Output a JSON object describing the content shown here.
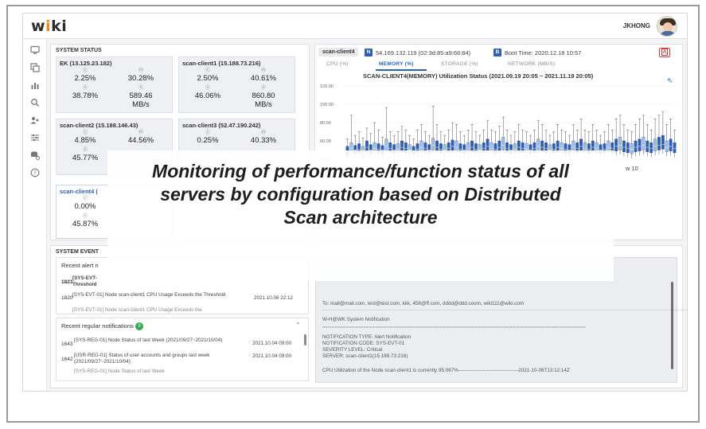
{
  "app": {
    "logo_text": "wiki",
    "user_name": "JKHONG"
  },
  "sidebar": {
    "icons": [
      "monitor-icon",
      "refresh-icon",
      "bar-chart-icon",
      "search-icon",
      "users-icon",
      "sliders-icon",
      "database-settings-icon",
      "help-icon"
    ]
  },
  "system_status": {
    "title": "SYSTEM STATUS",
    "cards": [
      {
        "name": "EK (13.125.23.182)",
        "cpu": "2.25%",
        "memory": "30.28%",
        "storage": "38.78%",
        "network": "589.46",
        "network_unit": "MB/s"
      },
      {
        "name": "scan-client1 (15.188.73.216)",
        "cpu": "2.50%",
        "memory": "40.61%",
        "storage": "46.06%",
        "network": "860.80",
        "network_unit": "MB/s"
      },
      {
        "name": "scan-client2 (15.188.146.43)",
        "cpu": "4.85%",
        "memory": "44.56%",
        "storage": "45.77%"
      },
      {
        "name": "scan-client3 (52.47.190.242)",
        "cpu": "0.25%",
        "memory": "40.33%"
      },
      {
        "name": "scan-client4 (",
        "cpu": "0.00%",
        "storage": "45.87%"
      }
    ]
  },
  "detail": {
    "host_tag": "scan-client4",
    "net_badge": "N",
    "net_info": "54.169.132.119 (02:3d:85:a9:66:84)",
    "boot_badge": "B",
    "boot_info": "Boot Time: 2020.12.18 10:57",
    "tabs": [
      "CPU (%)",
      "MEMORY (%)",
      "STORAGE (%)",
      "NETWORK (MB/S)"
    ],
    "chart_title": "SCAN-CLIENT4(MEMORY) Utilization Status (2021.09.19 20:05 ~ 2021.11.19 20:05)",
    "x_visible_label": "w 10"
  },
  "chart_data": {
    "type": "box",
    "title": "SCAN-CLIENT4(MEMORY) Utilization Status (2021.09.19 20:05 ~ 2021.11.19 20:05)",
    "ylim": [
      40,
      120
    ],
    "y_ticks": [
      "120.00",
      "100.00",
      "80.00",
      "60.00",
      "40.00"
    ],
    "series": [
      {
        "name": "",
        "color": "#2e5fb8",
        "median": [
          48,
          52,
          50,
          51,
          49,
          53,
          50,
          52,
          51,
          50,
          54,
          52,
          50,
          51,
          53,
          52,
          50,
          49,
          51,
          53,
          52,
          50,
          55,
          53,
          51,
          50,
          52,
          54,
          53,
          51,
          50,
          52,
          53,
          51,
          50,
          52,
          54,
          52,
          51,
          53,
          55,
          52,
          50,
          51,
          53,
          52,
          51,
          50,
          52,
          54,
          53,
          52,
          50,
          51,
          53,
          52,
          51,
          50,
          53,
          52,
          54,
          52,
          51,
          53,
          52,
          50,
          51,
          53,
          52,
          54,
          55,
          53,
          52,
          51,
          53,
          54,
          55,
          53,
          52,
          54,
          55,
          56,
          53,
          54,
          52
        ],
        "q1": [
          44,
          47,
          46,
          47,
          45,
          48,
          46,
          47,
          46,
          45,
          49,
          47,
          46,
          47,
          48,
          47,
          46,
          45,
          47,
          48,
          47,
          46,
          50,
          48,
          47,
          46,
          47,
          49,
          48,
          47,
          46,
          47,
          48,
          47,
          46,
          47,
          49,
          47,
          46,
          48,
          50,
          47,
          46,
          47,
          48,
          47,
          46,
          46,
          47,
          49,
          48,
          47,
          46,
          47,
          48,
          47,
          46,
          46,
          48,
          47,
          49,
          47,
          46,
          48,
          47,
          46,
          47,
          48,
          47,
          49,
          50,
          48,
          47,
          46,
          48,
          49,
          50,
          48,
          47,
          49,
          50,
          51,
          48,
          49,
          47
        ],
        "q3": [
          54,
          58,
          55,
          57,
          54,
          60,
          56,
          58,
          57,
          55,
          62,
          58,
          56,
          57,
          60,
          58,
          56,
          54,
          57,
          60,
          58,
          56,
          63,
          60,
          57,
          56,
          58,
          61,
          60,
          57,
          56,
          58,
          60,
          57,
          56,
          58,
          62,
          58,
          57,
          60,
          64,
          58,
          56,
          57,
          60,
          58,
          57,
          56,
          58,
          62,
          60,
          58,
          56,
          57,
          60,
          58,
          57,
          56,
          60,
          58,
          62,
          58,
          57,
          60,
          58,
          56,
          57,
          60,
          58,
          62,
          64,
          60,
          58,
          57,
          60,
          62,
          64,
          60,
          58,
          62,
          64,
          66,
          60,
          62,
          58
        ],
        "whisker_low": [
          40,
          42,
          41,
          42,
          40,
          43,
          41,
          42,
          41,
          40,
          44,
          42,
          41,
          42,
          43,
          42,
          41,
          40,
          42,
          43,
          42,
          41,
          45,
          43,
          42,
          41,
          42,
          44,
          43,
          42,
          41,
          42,
          43,
          42,
          41,
          42,
          44,
          42,
          41,
          43,
          45,
          42,
          41,
          42,
          43,
          42,
          41,
          41,
          42,
          44,
          43,
          42,
          41,
          42,
          43,
          42,
          41,
          41,
          43,
          42,
          44,
          42,
          41,
          43,
          42,
          41,
          42,
          43,
          42,
          44,
          45,
          43,
          42,
          41,
          43,
          44,
          45,
          43,
          42,
          44,
          45,
          46,
          43,
          44,
          42
        ],
        "whisker_high": [
          62,
          88,
          66,
          70,
          63,
          74,
          68,
          80,
          72,
          64,
          96,
          70,
          66,
          70,
          76,
          72,
          66,
          62,
          72,
          78,
          70,
          66,
          98,
          78,
          70,
          66,
          72,
          80,
          78,
          70,
          66,
          72,
          78,
          70,
          66,
          72,
          82,
          72,
          70,
          76,
          86,
          72,
          66,
          70,
          78,
          72,
          70,
          66,
          72,
          82,
          78,
          72,
          66,
          70,
          78,
          72,
          70,
          66,
          78,
          72,
          84,
          72,
          70,
          78,
          72,
          66,
          70,
          78,
          72,
          84,
          88,
          78,
          72,
          70,
          78,
          84,
          88,
          78,
          72,
          84,
          88,
          92,
          78,
          84,
          72
        ]
      }
    ]
  },
  "events": {
    "title": "SYSTEM EVENT",
    "alert_header": "Recent alert n",
    "alerts": [
      {
        "id": "1821",
        "text": "[SYS-EVT-",
        "text2": "Threshold",
        "date": ""
      },
      {
        "id": "1820",
        "text": "[SYS-EVT-01] Node scan-client1 CPU Usage Exceeds the Threshold",
        "date": "2021.10.06 22:12"
      },
      {
        "id": "",
        "text": "[SYS-EVT-01] Node scan-client1 CPU Usage Exceeds the",
        "date": ""
      }
    ],
    "regular_header": "Recent regular notifications",
    "regular_count": "9",
    "regular": [
      {
        "id": "1643",
        "text": "[SYS-REG-01] Node Status of last Week (2021/09/27~2021/10/04)",
        "date": "2021.10.04 09:00"
      },
      {
        "id": "1642",
        "text": "[USR-REG-01] Status of user accounts and groups last week (2021/09/27~2021/10/04)",
        "date": "2021.10.04 09:00"
      },
      {
        "id": "",
        "text": "[SYS-REG-01] Node Status of last Week",
        "date": ""
      }
    ]
  },
  "mail": {
    "to_line": "To: mail@mail.com, test@test.com, kkk, 456@ff.com, dddd@ddd.coom, wiki111@wiki.com",
    "from_line": "W-H@WK System Notification",
    "separator": "==========================================================================================",
    "type_line": "NOTIFICATION TYPE: Alert Notification",
    "code_line": "NOTIFICATION CODE: SYS-EVT-01",
    "severity_line": "SEVERITY LEVEL: Critical",
    "server_line": "SERVER: scan-client1(15.188.73.216)",
    "body_line": "CPU Utilization of the Node scan-client1 is currently 95.067%------------------------------------2021-10-06T13:12:14Z"
  },
  "overlay": {
    "text": "Monitoring of performance/function status of all servers by configuration based on Distributed Scan architecture"
  }
}
